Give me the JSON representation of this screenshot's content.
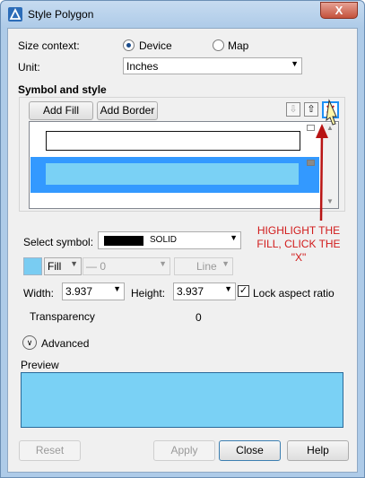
{
  "window": {
    "title": "Style Polygon",
    "close_glyph": "X"
  },
  "context": {
    "label": "Size context:",
    "options": [
      "Device",
      "Map"
    ],
    "selected": "Device"
  },
  "unit": {
    "label": "Unit:",
    "value": "Inches"
  },
  "symbol_style": {
    "heading": "Symbol and style",
    "add_fill": "Add Fill",
    "add_border": "Add Border",
    "icons": [
      "arrow-down-icon",
      "arrow-up-icon",
      "delete-x-icon"
    ]
  },
  "select_symbol": {
    "label": "Select symbol:",
    "value": "SOLID"
  },
  "fill_row": {
    "fill_label": "Fill",
    "line_value": "— 0",
    "line_label": "Line",
    "swatch_color": "#79ccf2"
  },
  "dimensions": {
    "width_label": "Width:",
    "width_value": "3.937",
    "height_label": "Height:",
    "height_value": "3.937",
    "lock_label": "Lock aspect ratio",
    "lock_checked": true
  },
  "transparency": {
    "label": "Transparency",
    "value": "0"
  },
  "advanced": {
    "label": "Advanced"
  },
  "preview": {
    "label": "Preview",
    "color": "#7ad1f5"
  },
  "buttons": {
    "reset": "Reset",
    "apply": "Apply",
    "close": "Close",
    "help": "Help"
  },
  "annotation": {
    "line1": "HIGHLIGHT THE",
    "line2": "FILL, CLICK THE",
    "line3": "\"X\""
  },
  "colors": {
    "accent": "#1e90f5",
    "selection": "#3399ff",
    "annotation": "#d11a1a"
  }
}
